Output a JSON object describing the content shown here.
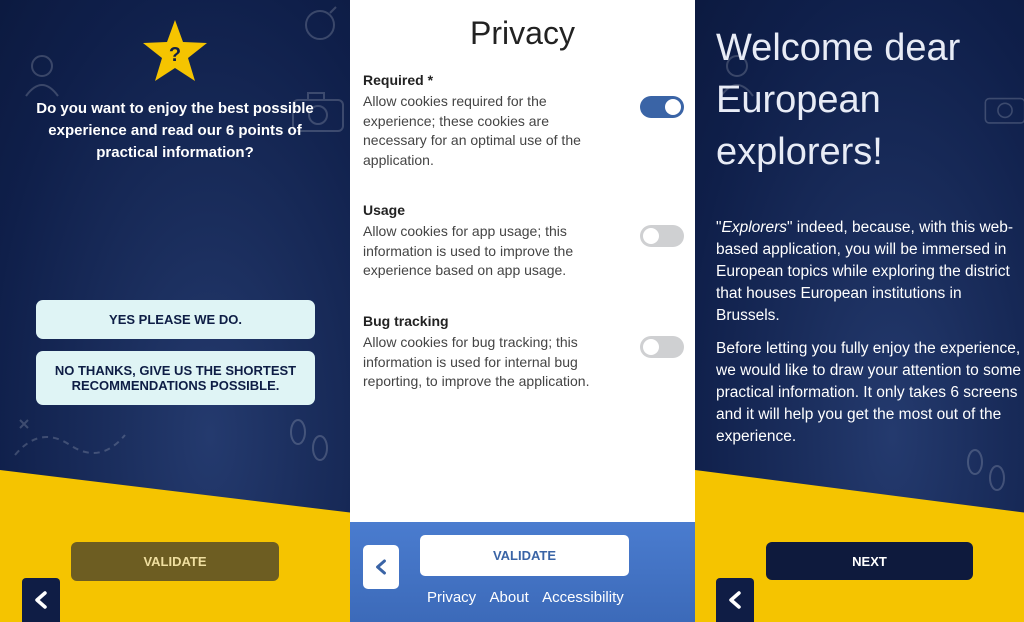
{
  "onboarding": {
    "question": "Do you want to enjoy the best possible experience and read our 6 points of practical information?",
    "yes_label": "YES PLEASE WE DO.",
    "no_label": "NO THANKS, GIVE US THE SHORTEST RECOMMENDATIONS POSSIBLE.",
    "validate_label": "VALIDATE",
    "star_symbol": "?"
  },
  "privacy": {
    "title": "Privacy",
    "options": [
      {
        "title": "Required *",
        "description": "Allow cookies required for the experience; these cookies are necessary for an optimal use of the application.",
        "enabled": true
      },
      {
        "title": "Usage",
        "description": "Allow cookies for app usage; this information is used to improve the experience based on app usage.",
        "enabled": false
      },
      {
        "title": "Bug tracking",
        "description": "Allow cookies for bug tracking; this information is used for internal bug reporting, to improve the application.",
        "enabled": false
      }
    ],
    "validate_label": "VALIDATE",
    "footer_links": [
      "Privacy",
      "About",
      "Accessibility"
    ]
  },
  "welcome": {
    "title": "Welcome dear European explorers!",
    "para1_open_quote": "\"",
    "para1_em": "Explorers",
    "para1_rest": "\" indeed, because, with this web-based application, you will be immersed in European topics while exploring the district that houses European institutions in Brussels.",
    "para2": "Before letting you fully enjoy the experience, we would like to draw your attention to some practical information. It only takes 6 screens and it will help you get the most out of the experience.",
    "next_label": "NEXT"
  },
  "colors": {
    "navy": "#0f1f4a",
    "yellow": "#f5c400",
    "light_button": "#dff4f5",
    "blue_accent": "#3a64a6"
  },
  "icons": {
    "back": "chevron-left-icon",
    "star": "star-icon"
  }
}
